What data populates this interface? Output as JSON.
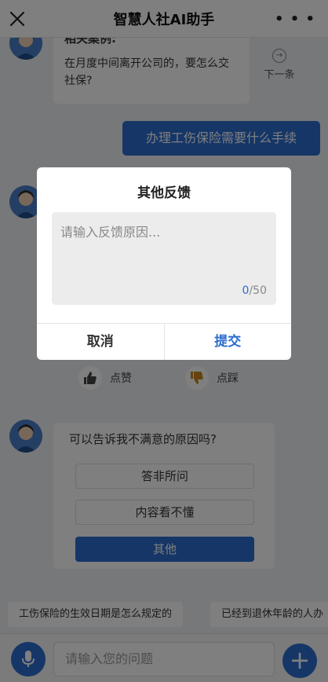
{
  "header": {
    "title": "智慧人社AI助手"
  },
  "chat": {
    "question_card": {
      "title": "相关案例:",
      "text": "在月度中间离开公司的，要怎么交社保?"
    },
    "next_label": "下一条",
    "user_message": "办理工伤保险需要什么手续",
    "like_label": "点赞",
    "dislike_label": "点踩",
    "reason": {
      "prompt": "可以告诉我不满意的原因吗?",
      "options": [
        "答非所问",
        "内容看不懂",
        "其他"
      ]
    }
  },
  "suggestions": [
    "工伤保险的生效日期是怎么规定的",
    "已经到退休年龄的人办"
  ],
  "input": {
    "placeholder": "请输入您的问题"
  },
  "modal": {
    "title": "其他反馈",
    "placeholder": "请输入反馈原因...",
    "count_current": "0",
    "count_max": "/50",
    "cancel_label": "取消",
    "submit_label": "提交"
  },
  "colors": {
    "accent": "#2a6ccf",
    "overlay": "rgba(0,0,0,0.5)"
  }
}
